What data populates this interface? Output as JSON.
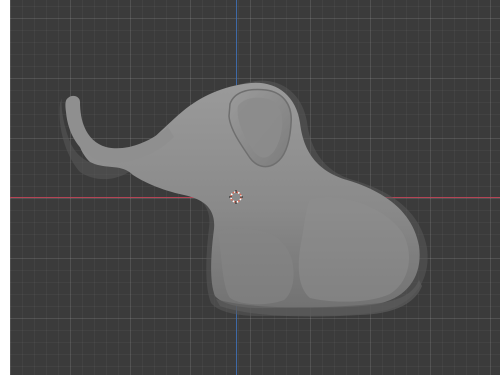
{
  "viewport": {
    "name": "3D viewport",
    "background_color": "#3b3b3b",
    "x_axis_color": "#b54455",
    "y_axis_color": "#3f6fb3"
  },
  "object": {
    "name": "elephant-model",
    "color": "#8c8c8c"
  },
  "icons": {
    "origin": "3d-cursor-icon"
  }
}
